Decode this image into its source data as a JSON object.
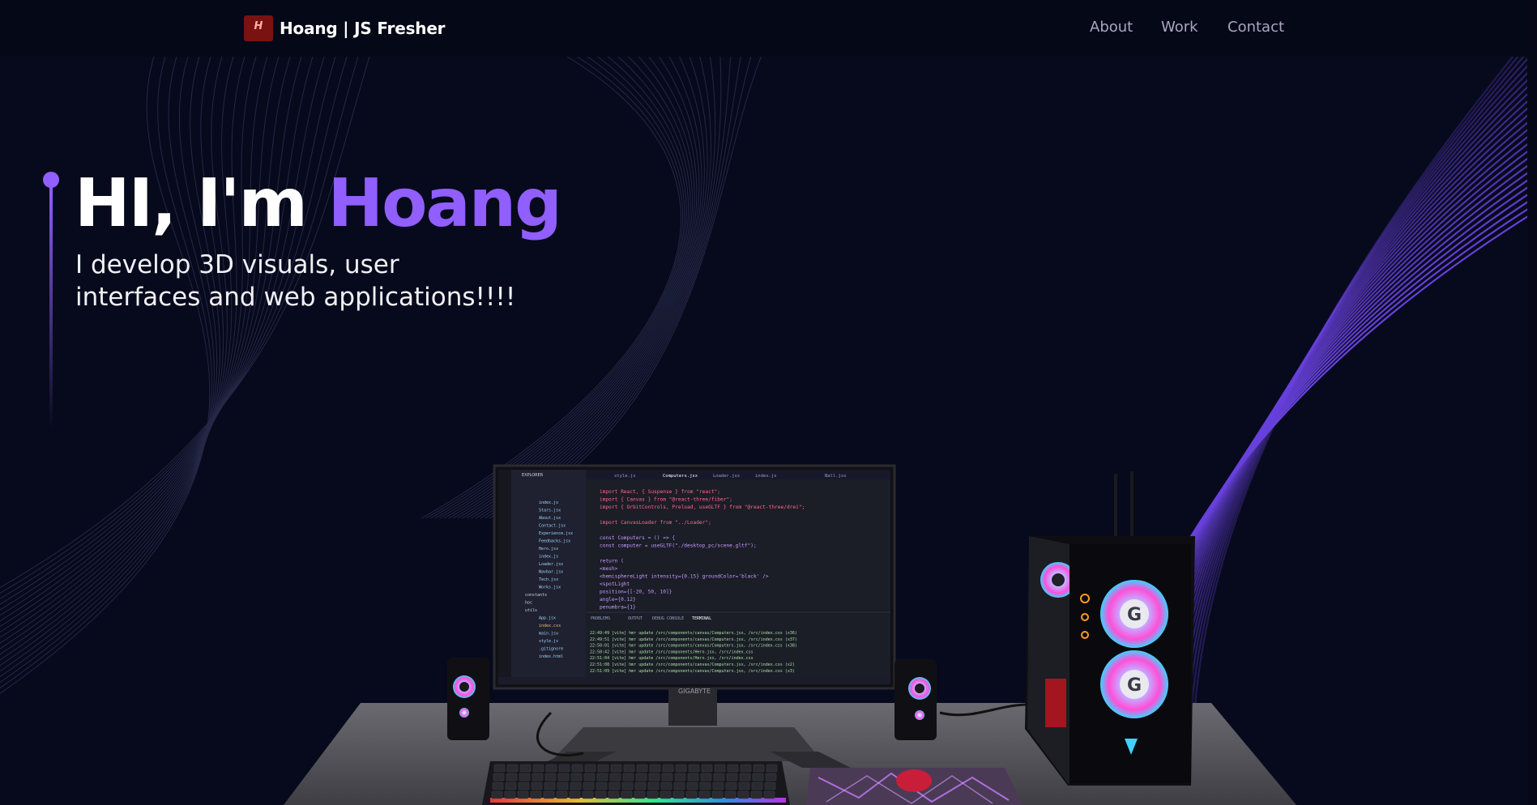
{
  "navbar": {
    "logo_icon": "hoang-logo-icon",
    "logo_letter": "H",
    "brand": "Hoang | JS Fresher",
    "links": [
      "About",
      "Work",
      "Contact"
    ]
  },
  "hero": {
    "greeting": "HI, I'm ",
    "name": "Hoang",
    "subtitle_line1": "I develop 3D visuals, user",
    "subtitle_line2": "interfaces and web applications!!!!"
  },
  "scene": {
    "monitor_brand": "GIGABYTE",
    "editor_tabs": [
      "style.js",
      "Computers.jsx",
      "Loader.jsx",
      "index.js",
      "Ball.jsx"
    ],
    "editor_panels": [
      "PROBLEMS",
      "OUTPUT",
      "DEBUG CONSOLE",
      "TERMINAL"
    ],
    "explorer_title": "EXPLORER",
    "explorer_files": [
      "index.js",
      "Stars.jsx",
      "About.jsx",
      "Contact.jsx",
      "Experience.jsx",
      "Feedbacks.jsx",
      "Hero.jsx",
      "index.js",
      "Loader.jsx",
      "Navbar.jsx",
      "Tech.jsx",
      "Works.jsx",
      "constants",
      "hoc",
      "utils",
      "App.jsx",
      "index.css",
      "main.jsx",
      "style.js",
      ".gitignore",
      "index.html"
    ],
    "code_lines": [
      "import React, { Suspense } from \"react\";",
      "import { Canvas } from \"@react-three/fiber\";",
      "import { OrbitControls, Preload, useGLTF } from \"@react-three/drei\";",
      "",
      "import CanvasLoader from \"../Loader\";",
      "",
      "const Computers = () => {",
      "  const computer = useGLTF(\"./desktop_pc/scene.gltf\");",
      "",
      "  return (",
      "    <mesh>",
      "      <hemisphereLight intensity={0.15} groundColor='black' />",
      "      <spotLight",
      "        position={[-20, 50, 10]}",
      "        angle={0.12}",
      "        penumbra={1}"
    ],
    "terminal_lines": [
      "22:49:49 [vite] hmr update /src/components/canvas/Computers.jsx, /src/index.css (x36)",
      "22:49:51 [vite] hmr update /src/components/canvas/Computers.jsx, /src/index.css (x37)",
      "22:50:01 [vite] hmr update /src/components/canvas/Computers.jsx, /src/index.css (x38)",
      "22:50:42 [vite] hmr update /src/components/Hero.jsx, /src/index.css",
      "22:51:04 [vite] hmr update /src/components/Hero.jsx, /src/index.css",
      "22:51:08 [vite] hmr update /src/components/canvas/Computers.jsx, /src/index.css (x2)",
      "22:51:09 [vite] hmr update /src/components/canvas/Computers.jsx, /src/index.css (x3)"
    ],
    "colors": {
      "accent": "#915eff",
      "background": "#050816",
      "rgb_ring": "#ff4fd8",
      "rgb_ring2": "#3fd2ff"
    }
  }
}
